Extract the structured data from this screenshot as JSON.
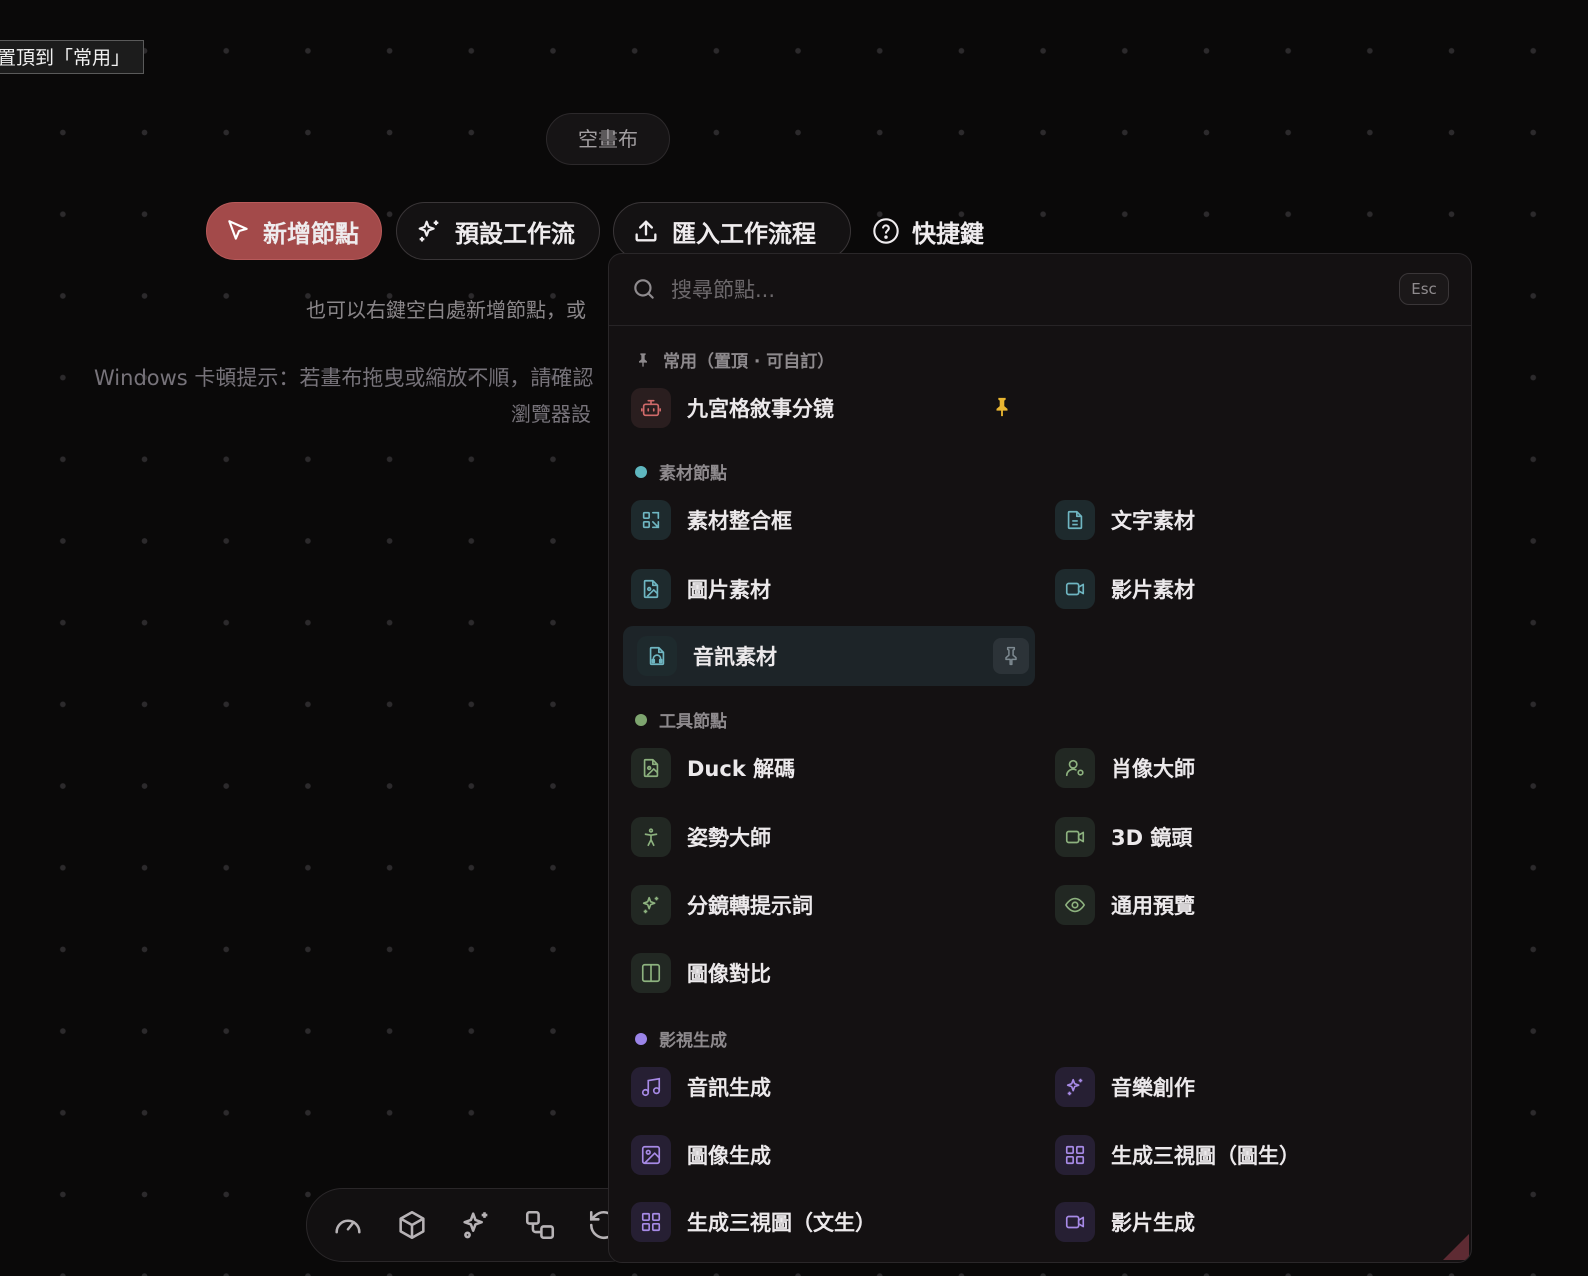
{
  "tooltip": "置頂到「常用」",
  "canvas": {
    "empty_label": "空畫布",
    "hint_line1": "也可以右鍵空白處新增節點，或",
    "hint_line2": "Windows 卡頓提示：若畫布拖曳或縮放不順，請確認",
    "hint_line3": "瀏覽器設"
  },
  "toolbar": {
    "add_node": "新增節點",
    "preset_workflow": "預設工作流",
    "import_workflow": "匯入工作流程",
    "shortcuts": "快捷鍵"
  },
  "bottom_bar": {
    "icons": [
      "gauge-icon",
      "cube-icon",
      "sparkles-icon",
      "nodes-icon",
      "history-icon"
    ]
  },
  "panel": {
    "search_placeholder": "搜尋節點...",
    "search_value": "",
    "esc_label": "Esc",
    "sections": {
      "favorites": {
        "title": "常用（置頂 · 可自訂）",
        "items": [
          {
            "label": "九宮格敘事分镜",
            "icon": "robot-icon",
            "pinned": true
          }
        ]
      },
      "material": {
        "title": "素材節點",
        "color": "#5fb7bf",
        "items": [
          {
            "label": "素材整合框",
            "icon": "scan-icon"
          },
          {
            "label": "文字素材",
            "icon": "file-text-icon"
          },
          {
            "label": "圖片素材",
            "icon": "file-image-icon"
          },
          {
            "label": "影片素材",
            "icon": "video-icon"
          },
          {
            "label": "音訊素材",
            "icon": "file-audio-icon"
          }
        ]
      },
      "tools": {
        "title": "工具節點",
        "color": "#7ea56f",
        "items": [
          {
            "label": "Duck 解碼",
            "icon": "file-image-icon"
          },
          {
            "label": "肖像大師",
            "icon": "user-cog-icon"
          },
          {
            "label": "姿勢大師",
            "icon": "person-standing-icon"
          },
          {
            "label": "3D 鏡頭",
            "icon": "video-icon"
          },
          {
            "label": "分鏡轉提示詞",
            "icon": "sparkles-icon"
          },
          {
            "label": "通用預覽",
            "icon": "eye-icon"
          },
          {
            "label": "圖像對比",
            "icon": "columns-icon"
          }
        ]
      },
      "video_gen": {
        "title": "影視生成",
        "color": "#9b84e8",
        "items": [
          {
            "label": "音訊生成",
            "icon": "music-icon"
          },
          {
            "label": "音樂創作",
            "icon": "sparkles-icon"
          },
          {
            "label": "圖像生成",
            "icon": "image-icon"
          },
          {
            "label": "生成三視圖（圖生）",
            "icon": "grid-icon"
          },
          {
            "label": "生成三視圖（文生）",
            "icon": "grid-icon"
          },
          {
            "label": "影片生成",
            "icon": "video-icon"
          }
        ]
      }
    }
  }
}
